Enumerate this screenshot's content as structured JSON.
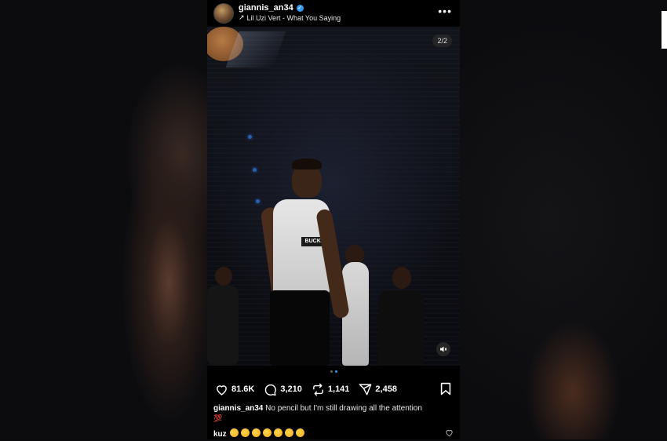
{
  "post": {
    "username": "giannis_an34",
    "verified": true,
    "music": "Lil Uzi Vert - What You Saying",
    "page_indicator": "2/2",
    "jersey_text": "BUCKS",
    "carousel": {
      "total": 2,
      "active": 2
    },
    "stats": {
      "likes": "81.6K",
      "comments": "3,210",
      "reposts": "1,141",
      "shares": "2,458"
    },
    "caption": {
      "user": "giannis_an34",
      "text": "No pencil but I'm still drawing all the attention",
      "emoji": "💯"
    },
    "comment": {
      "user": "kuz",
      "emoji_count": 7
    }
  },
  "icons": {
    "more": "more-options-icon",
    "music": "music-arrow-icon",
    "like": "heart-icon",
    "comment": "comment-icon",
    "repost": "repost-icon",
    "share": "share-icon",
    "save": "bookmark-icon",
    "mute": "muted-speaker-icon"
  },
  "colors": {
    "verified": "#3897f0",
    "background": "#000000"
  }
}
